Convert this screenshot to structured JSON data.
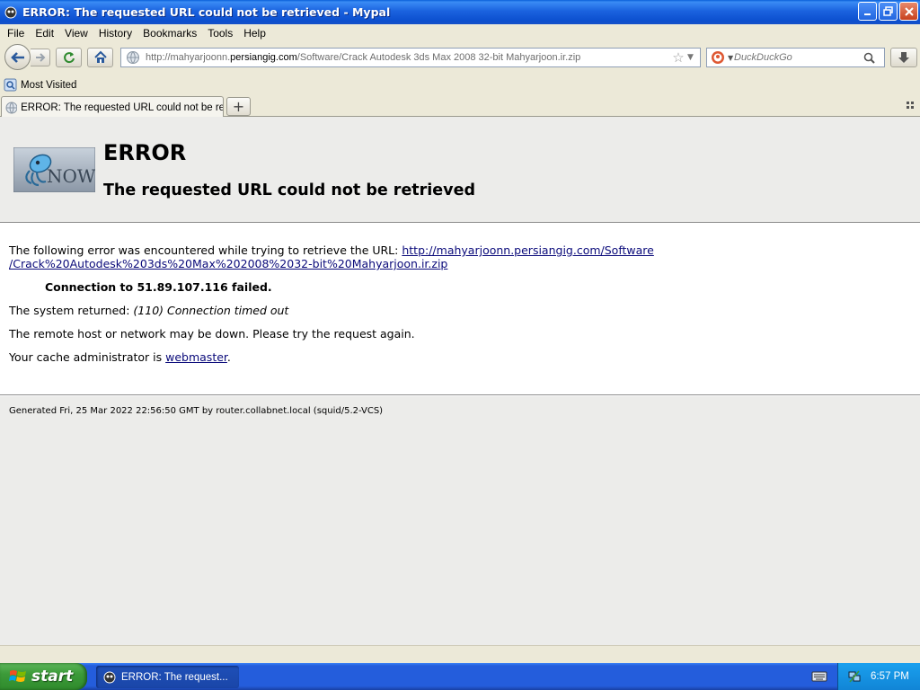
{
  "window": {
    "title": "ERROR: The requested URL could not be retrieved - Mypal"
  },
  "menu": {
    "items": [
      "File",
      "Edit",
      "View",
      "History",
      "Bookmarks",
      "Tools",
      "Help"
    ]
  },
  "navbar": {
    "url_prefix": "http://mahyarjoonn.",
    "url_domain": "persiangig.com",
    "url_suffix": "/Software/Crack Autodesk 3ds Max 2008 32-bit Mahyarjoon.ir.zip",
    "search_placeholder": "DuckDuckGo"
  },
  "bookmarks": {
    "most_visited": "Most Visited"
  },
  "tabs": [
    {
      "label": "ERROR: The requested URL could not be ret..."
    }
  ],
  "page": {
    "heading": "ERROR",
    "subheading": "The requested URL could not be retrieved",
    "intro": "The following error was encountered while trying to retrieve the URL: ",
    "link_line1": "http://mahyarjoonn.persiangig.com/Software",
    "link_line2": "/Crack%20Autodesk%203ds%20Max%202008%2032-bit%20Mahyarjoon.ir.zip",
    "connection_msg": "Connection to 51.89.107.116 failed.",
    "system_returned_label": "The system returned: ",
    "system_returned_value": "(110) Connection timed out",
    "remote_msg": "The remote host or network may be down. Please try the request again.",
    "cache_admin_label": "Your cache administrator is ",
    "webmaster_link": "webmaster",
    "cache_admin_end": ".",
    "footer": "Generated Fri, 25 Mar 2022 22:56:50 GMT by router.collabnet.local (squid/5.2-VCS)",
    "logo_text": "NOW"
  },
  "taskbar": {
    "start_label": "start",
    "task_label": "ERROR: The request...",
    "clock": "6:57 PM"
  }
}
